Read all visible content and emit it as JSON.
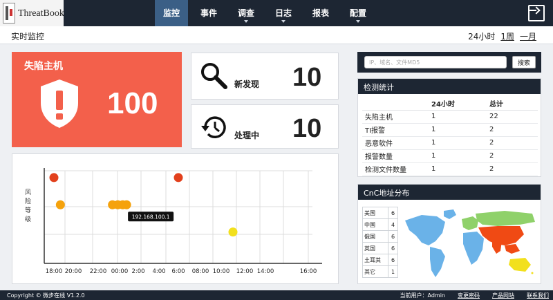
{
  "app": {
    "logo_text": "ThreatBook"
  },
  "nav": {
    "items": [
      {
        "label": "监控",
        "active": true
      },
      {
        "label": "事件",
        "active": false
      },
      {
        "label": "调查",
        "active": false
      },
      {
        "label": "日志",
        "active": false
      },
      {
        "label": "报表",
        "active": false
      },
      {
        "label": "配置",
        "active": false
      }
    ]
  },
  "subheader": {
    "title": "实时监控",
    "ranges": [
      "24小时",
      "1周",
      "一月"
    ]
  },
  "compromised": {
    "label": "失陷主机",
    "value": "100",
    "color": "#f3604b"
  },
  "new_found": {
    "label": "新发现",
    "value": "10"
  },
  "processing": {
    "label": "处理中",
    "value": "10"
  },
  "search": {
    "placeholder": "IP、域名、文件MD5",
    "button": "搜索"
  },
  "stats": {
    "title": "检测统计",
    "columns": [
      "",
      "24小时",
      "总计"
    ],
    "rows": [
      {
        "name": "失陷主机",
        "h24": "1",
        "total": "22"
      },
      {
        "name": "TI报警",
        "h24": "1",
        "total": "2"
      },
      {
        "name": "恶意软件",
        "h24": "1",
        "total": "2"
      },
      {
        "name": "报警数量",
        "h24": "1",
        "total": "2"
      },
      {
        "name": "检测文件数量",
        "h24": "1",
        "total": "2"
      }
    ]
  },
  "cnc": {
    "title": "CnC地址分布",
    "rows": [
      {
        "country": "美国",
        "count": "6"
      },
      {
        "country": "中国",
        "count": "4"
      },
      {
        "country": "俄国",
        "count": "6"
      },
      {
        "country": "英国",
        "count": "6"
      },
      {
        "country": "土耳其",
        "count": "6"
      },
      {
        "country": "其它",
        "count": "1"
      }
    ]
  },
  "chart_data": {
    "type": "scatter",
    "title": "",
    "ylabel": "风险等级",
    "xlabel": "",
    "x_ticks": [
      "18:00",
      "20:00",
      "22:00",
      "00:00",
      "2:00",
      "4:00",
      "6:00",
      "08:00",
      "10:00",
      "12:00",
      "14:00",
      "16:00"
    ],
    "y_levels": 3,
    "grid": true,
    "points": [
      {
        "x": "18:00",
        "level": 3,
        "color": "#e2401c"
      },
      {
        "x": "18:40",
        "level": 2,
        "color": "#f5a20c"
      },
      {
        "x": "23:20",
        "level": 2,
        "color": "#f5a20c"
      },
      {
        "x": "23:50",
        "level": 2,
        "color": "#f5a20c"
      },
      {
        "x": "00:20",
        "level": 2,
        "color": "#f5a20c"
      },
      {
        "x": "00:45",
        "level": 2,
        "color": "#f5a20c"
      },
      {
        "x": "6:00",
        "level": 3,
        "color": "#e2401c"
      },
      {
        "x": "11:00",
        "level": 1,
        "color": "#f2e01d"
      }
    ],
    "tooltip": {
      "text": "192.168.100.1"
    }
  },
  "footer": {
    "copyright": "Copyright © 微步在线 V1.2.0",
    "user": "当前用户：Admin",
    "links": [
      "变更密码",
      "产品网站",
      "联系我们"
    ]
  }
}
